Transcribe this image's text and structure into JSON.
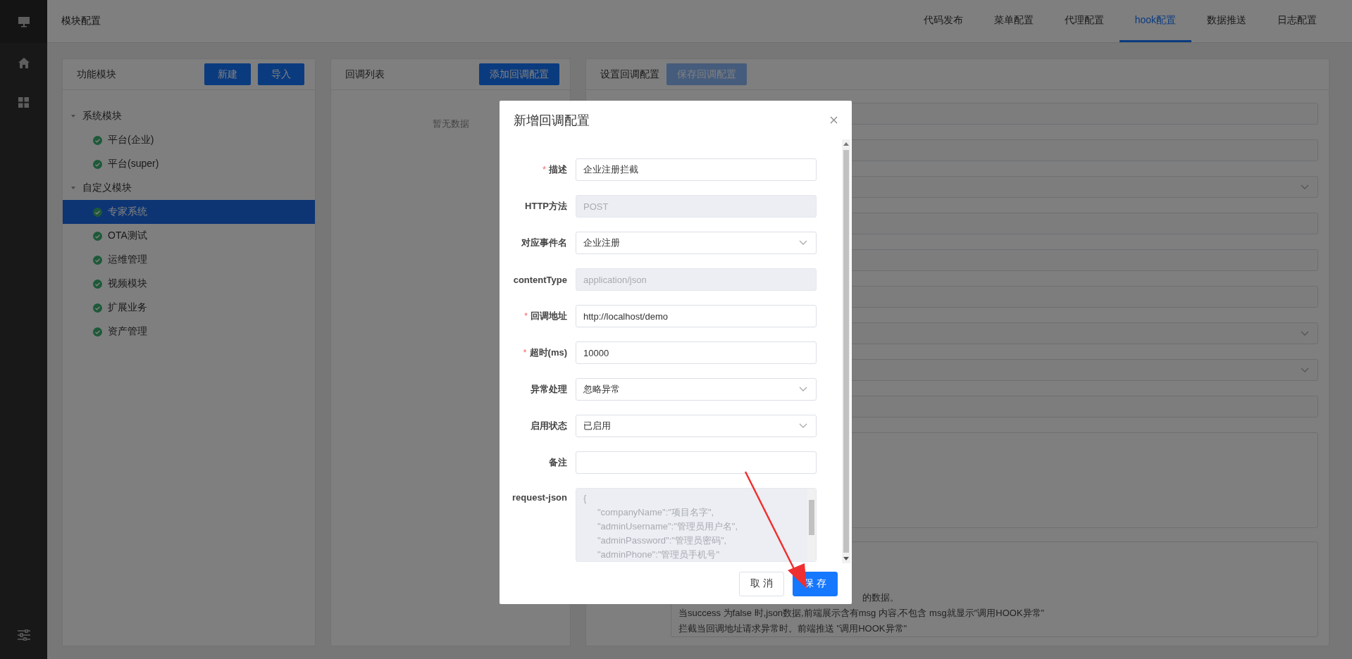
{
  "header": {
    "title": "模块配置",
    "tabs": [
      {
        "label": "代码发布",
        "selected": false
      },
      {
        "label": "菜单配置",
        "selected": false
      },
      {
        "label": "代理配置",
        "selected": false
      },
      {
        "label": "hook配置",
        "selected": true
      },
      {
        "label": "数据推送",
        "selected": false
      },
      {
        "label": "日志配置",
        "selected": false
      }
    ]
  },
  "module_panel": {
    "title": "功能模块",
    "buttons": [
      "新建",
      "导入"
    ],
    "tree": [
      {
        "label": "系统模块",
        "expanded": true,
        "children": [
          {
            "label": "平台(企业)",
            "selected": false
          },
          {
            "label": "平台(super)",
            "selected": false
          }
        ]
      },
      {
        "label": "自定义模块",
        "expanded": true,
        "children": [
          {
            "label": "专家系统",
            "selected": true
          },
          {
            "label": "OTA测试",
            "selected": false
          },
          {
            "label": "运维管理",
            "selected": false
          },
          {
            "label": "视频模块",
            "selected": false
          },
          {
            "label": "扩展业务",
            "selected": false
          },
          {
            "label": "资产管理",
            "selected": false
          }
        ]
      }
    ]
  },
  "callback_list": {
    "title": "回调列表",
    "button": "添加回调配置",
    "empty_text": "暂无数据"
  },
  "config_panel": {
    "title": "设置回调配置",
    "save_button": {
      "label": "保存回调配置",
      "disabled": true
    },
    "fields": [
      {
        "kind": "input"
      },
      {
        "kind": "input"
      },
      {
        "kind": "select"
      },
      {
        "kind": "input"
      },
      {
        "kind": "input"
      },
      {
        "kind": "input"
      },
      {
        "kind": "select"
      },
      {
        "kind": "select"
      },
      {
        "kind": "input"
      },
      {
        "kind": "textarea"
      },
      {
        "kind": "textarea",
        "tail": "的数据。",
        "lines": [
          "当success 为false 时,json数据,前端展示含有msg 内容,不包含 msg就显示\"调用HOOK异常\"",
          "拦截当回调地址请求异常时。前端推送 \"调用HOOK异常\""
        ]
      }
    ]
  },
  "dialog": {
    "title": "新增回调配置",
    "fields": [
      {
        "mark": "*",
        "label": "描述",
        "kind": "input",
        "value": "企业注册拦截",
        "disabled": false
      },
      {
        "label": "HTTP方法",
        "kind": "input",
        "value": "POST",
        "disabled": true
      },
      {
        "label": "对应事件名",
        "kind": "select",
        "value": "企业注册",
        "disabled": false
      },
      {
        "label": "contentType",
        "kind": "input",
        "value": "application/json",
        "disabled": true
      },
      {
        "mark": "*",
        "label": "回调地址",
        "kind": "input",
        "value": "http://localhost/demo",
        "disabled": false
      },
      {
        "mark": "*",
        "label": "超时(ms)",
        "kind": "input",
        "value": "10000",
        "disabled": false
      },
      {
        "label": "异常处理",
        "kind": "select",
        "value": "忽略异常",
        "disabled": false
      },
      {
        "label": "启用状态",
        "kind": "select",
        "value": "已启用",
        "disabled": false
      },
      {
        "label": "备注",
        "kind": "input",
        "disabled": false
      },
      {
        "label": "request-json",
        "kind": "textarea",
        "disabled": true,
        "lines": [
          "{",
          "\"companyName\":\"项目名字\",",
          "\"adminUsername\":\"管理员用户名\",",
          "\"adminPassword\":\"管理员密码\",",
          "\"adminPhone\":\"管理员手机号\""
        ]
      }
    ],
    "buttons": [
      {
        "label": "取 消",
        "primary": false
      },
      {
        "label": "保 存",
        "primary": true
      }
    ]
  }
}
